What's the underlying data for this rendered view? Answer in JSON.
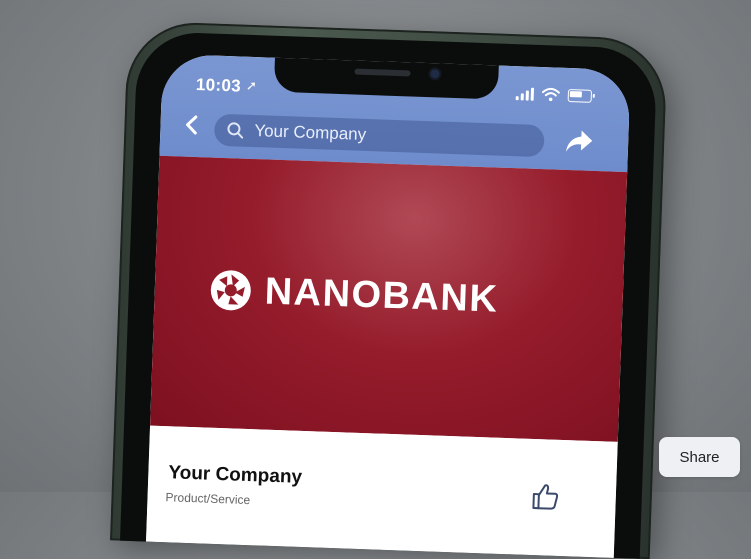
{
  "status_bar": {
    "time": "10:03",
    "location_icon": "location-arrow-icon",
    "signal_icon": "cellular-signal-icon",
    "wifi_icon": "wifi-icon",
    "battery_icon": "battery-icon"
  },
  "nav": {
    "back_icon": "chevron-left-icon",
    "search_icon": "search-icon",
    "search_value": "Your Company",
    "share_icon": "share-arrow-icon"
  },
  "cover": {
    "brand_name": "NANOBANK",
    "logo_icon": "nanobank-aperture-logo-icon",
    "background_color": "#951c2b"
  },
  "profile": {
    "page_name": "Your Company",
    "category": "Product/Service",
    "like_icon": "thumbs-up-icon"
  },
  "actions": {
    "share_label": "Share"
  },
  "colors": {
    "header_blue": "#6e8ccc",
    "cover_red": "#951c2b"
  }
}
